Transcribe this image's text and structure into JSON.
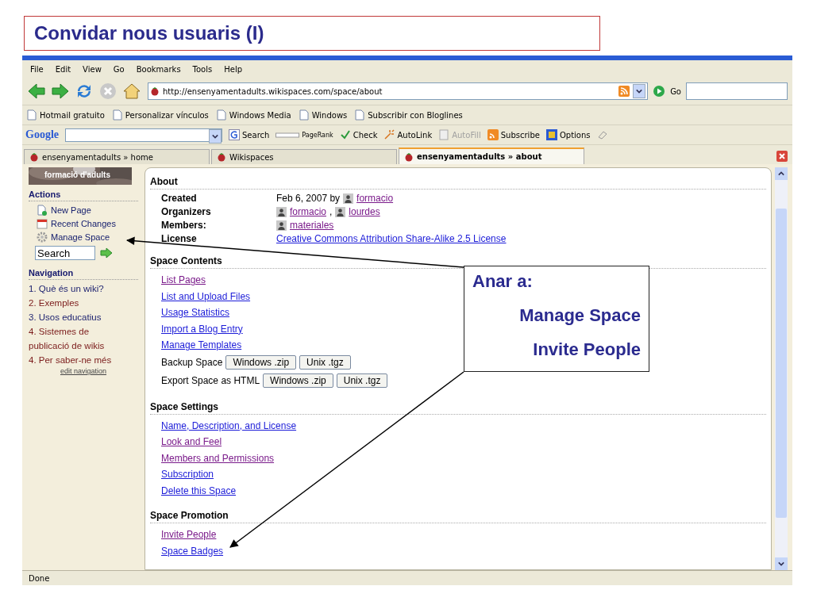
{
  "slide_title": "Convidar nous usuaris (I)",
  "menu": [
    "File",
    "Edit",
    "View",
    "Go",
    "Bookmarks",
    "Tools",
    "Help"
  ],
  "address": "http://ensenyamentadults.wikispaces.com/space/about",
  "go_label": "Go",
  "bookmarks": [
    "Hotmail gratuito",
    "Personalizar vínculos",
    "Windows Media",
    "Windows",
    "Subscribir con Bloglines"
  ],
  "google_toolbar": {
    "logo": "Google",
    "items": [
      {
        "kind": "search",
        "label": "Search",
        "disabled": false
      },
      {
        "kind": "pagerank",
        "label": "PageRank",
        "disabled": false
      },
      {
        "kind": "check",
        "label": "Check",
        "disabled": false
      },
      {
        "kind": "autolink",
        "label": "AutoLink",
        "disabled": false
      },
      {
        "kind": "autofill",
        "label": "AutoFill",
        "disabled": true
      },
      {
        "kind": "subscribe",
        "label": "Subscribe",
        "disabled": false
      },
      {
        "kind": "options",
        "label": "Options",
        "disabled": false
      }
    ]
  },
  "tabs": [
    {
      "label": "ensenyamentadults » home",
      "selected": false
    },
    {
      "label": "Wikispaces",
      "selected": false
    },
    {
      "label": "ensenyamentadults » about",
      "selected": true
    }
  ],
  "sidebar": {
    "logo_text": "formació d'adults",
    "actions_heading": "Actions",
    "actions": [
      {
        "kind": "page",
        "label": "New Page"
      },
      {
        "kind": "calendar",
        "label": "Recent Changes"
      },
      {
        "kind": "gear",
        "label": "Manage Space"
      }
    ],
    "search_value": "Search",
    "navigation_heading": "Navigation",
    "navigation": [
      {
        "number": "1.",
        "label": "Què és un wiki?",
        "visited": false
      },
      {
        "number": "2.",
        "label": "Exemples",
        "visited": true
      },
      {
        "number": "3.",
        "label": "Usos educatius",
        "visited": false
      },
      {
        "number": "4.",
        "label": "Sistemes de publicació de wikis",
        "visited": true
      },
      {
        "number": "4.",
        "label": "Per saber-ne més",
        "visited": true
      }
    ],
    "edit_link": "edit navigation"
  },
  "about": {
    "heading": "About",
    "rows": [
      {
        "label": "Created",
        "value": [
          {
            "kind": "text",
            "text": "Feb 6, 2007 by"
          },
          {
            "kind": "user",
            "text": "formacio",
            "visited": true
          }
        ]
      },
      {
        "label": "Organizers",
        "value": [
          {
            "kind": "user",
            "text": "formacio",
            "visited": true
          },
          {
            "kind": "text",
            "text": ","
          },
          {
            "kind": "user",
            "text": "lourdes",
            "visited": true
          }
        ]
      },
      {
        "label": "Members:",
        "value": [
          {
            "kind": "user",
            "text": "materiales",
            "visited": true
          }
        ]
      },
      {
        "label": "License",
        "value": [
          {
            "kind": "link",
            "text": "Creative Commons Attribution Share-Alike 2.5 License",
            "visited": false
          }
        ]
      }
    ]
  },
  "sections": [
    {
      "heading": "Space Contents",
      "items": [
        {
          "kind": "link",
          "text": "List Pages",
          "visited": true
        },
        {
          "kind": "link",
          "text": "List and Upload Files",
          "visited": false
        },
        {
          "kind": "link",
          "text": "Usage Statistics",
          "visited": false
        },
        {
          "kind": "link",
          "text": "Import a Blog Entry",
          "visited": false
        },
        {
          "kind": "link",
          "text": "Manage Templates",
          "visited": false
        },
        {
          "kind": "buttons",
          "text": "Backup Space",
          "buttons": [
            "Windows .zip",
            "Unix .tgz"
          ]
        },
        {
          "kind": "buttons",
          "text": "Export Space as HTML",
          "buttons": [
            "Windows .zip",
            "Unix .tgz"
          ]
        }
      ]
    },
    {
      "heading": "Space Settings",
      "items": [
        {
          "kind": "link",
          "text": "Name, Description, and License",
          "visited": false
        },
        {
          "kind": "link",
          "text": "Look and Feel",
          "visited": true
        },
        {
          "kind": "link",
          "text": "Members and Permissions",
          "visited": true
        },
        {
          "kind": "link",
          "text": "Subscription",
          "visited": false
        },
        {
          "kind": "link",
          "text": "Delete this Space",
          "visited": false
        }
      ]
    },
    {
      "heading": "Space Promotion",
      "items": [
        {
          "kind": "link",
          "text": "Invite People",
          "visited": true
        },
        {
          "kind": "link",
          "text": "Space Badges",
          "visited": false
        }
      ]
    }
  ],
  "callout": {
    "heading": "Anar a:",
    "lines": [
      "Manage Space",
      "Invite People"
    ]
  },
  "status": "Done"
}
